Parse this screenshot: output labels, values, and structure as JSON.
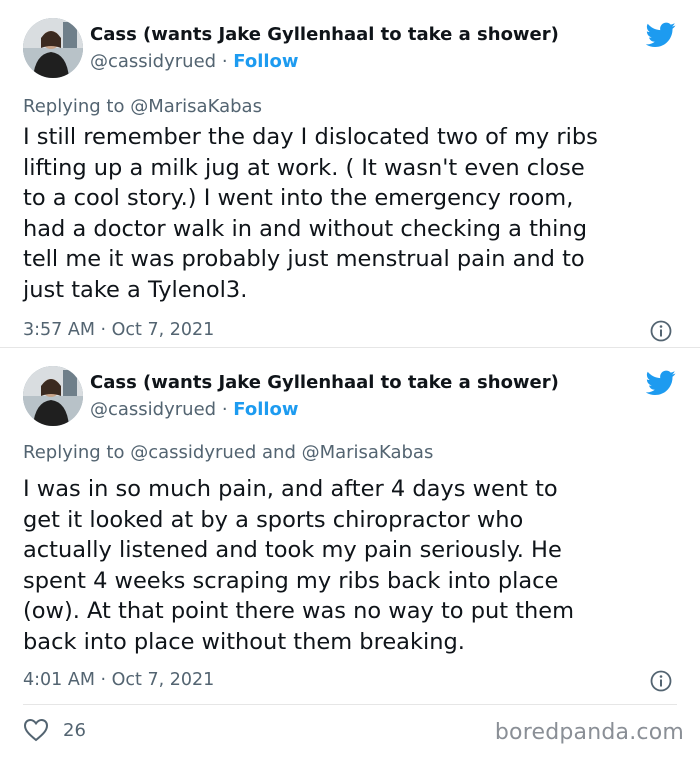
{
  "tweets": [
    {
      "author_name": "Cass (wants Jake Gyllenhaal to take a shower)",
      "handle": "@cassidyrued",
      "separator": "·",
      "follow_label": "Follow",
      "reply_prefix": "Replying to",
      "reply_to": "@MarisaKabas",
      "text": "I still remember the day I dislocated two of my ribs\nlifting up a milk jug at work. ( It wasn't even close\nto a cool story.) I went into the emergency room,\nhad a doctor walk in and without checking a thing\ntell me it was probably just menstrual pain and to\njust take a Tylenol3.",
      "timestamp": "3:57 AM · Oct 7, 2021"
    },
    {
      "author_name": "Cass (wants Jake Gyllenhaal to take a shower)",
      "handle": "@cassidyrued",
      "separator": "·",
      "follow_label": "Follow",
      "reply_prefix": "Replying to",
      "reply_to": "@cassidyrued and @MarisaKabas",
      "text": "I was in so much pain, and after 4 days went to\nget it looked at by a sports chiropractor who\nactually listened and took my pain seriously. He\nspent 4 weeks scraping my ribs back into place\n(ow). At that point there was no way to put them\nback into place without them breaking.",
      "timestamp": "4:01 AM · Oct 7, 2021"
    }
  ],
  "footer": {
    "like_count": "26",
    "watermark": "boredpanda.com"
  },
  "icons": {
    "brand": "twitter-bird-icon",
    "info": "info-icon",
    "like": "heart-icon"
  },
  "colors": {
    "accent": "#1d9bf0",
    "secondary_text": "#536471",
    "primary_text": "#0f1419"
  }
}
